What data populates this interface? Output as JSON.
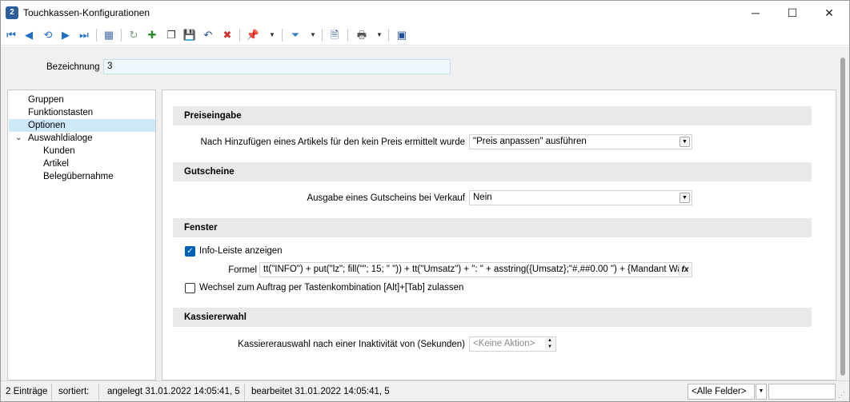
{
  "window": {
    "title": "Touchkassen-Konfigurationen",
    "app_icon_label": "2",
    "minimize_glyph": "─",
    "maximize_glyph": "☐",
    "close_glyph": "✕"
  },
  "toolbar": {
    "icons": [
      {
        "name": "first-record-icon",
        "glyph": "⏮",
        "color": "#1f6fc5"
      },
      {
        "name": "previous-record-icon",
        "glyph": "◀",
        "color": "#1f6fc5"
      },
      {
        "name": "refresh-record-icon",
        "glyph": "⟲",
        "color": "#1f6fc5"
      },
      {
        "name": "next-record-icon",
        "glyph": "▶",
        "color": "#1f6fc5"
      },
      {
        "name": "last-record-icon",
        "glyph": "⏭",
        "color": "#1f6fc5"
      },
      {
        "name": "table-view-icon",
        "glyph": "▦",
        "color": "#4a6fa5"
      },
      {
        "name": "reload-icon",
        "glyph": "↻",
        "color": "#7a9a7a"
      },
      {
        "name": "new-record-icon",
        "glyph": "✚",
        "color": "#2e8b2e"
      },
      {
        "name": "copy-record-icon",
        "glyph": "❐",
        "color": "#333333"
      },
      {
        "name": "save-icon",
        "glyph": "💾",
        "color": "#1f4f9c"
      },
      {
        "name": "undo-icon",
        "glyph": "↶",
        "color": "#1f4f9c"
      },
      {
        "name": "delete-record-icon",
        "glyph": "✖",
        "color": "#d03030"
      },
      {
        "name": "pin-icon",
        "glyph": "📌",
        "color": "#1f4f9c"
      },
      {
        "name": "filter-icon",
        "glyph": "⏷",
        "color": "#2f80d0"
      },
      {
        "name": "document-search-icon",
        "glyph": "🗎",
        "color": "#1f4f9c"
      },
      {
        "name": "print-icon",
        "glyph": "🖶",
        "color": "#555555"
      },
      {
        "name": "export-icon",
        "glyph": "▣",
        "color": "#1f4f9c"
      }
    ],
    "dropdown_glyph": "▼"
  },
  "header": {
    "bezeichnung_label": "Bezeichnung",
    "bezeichnung_value": "3"
  },
  "tree": {
    "expand_glyph": "⌄",
    "items": [
      {
        "label": "Gruppen"
      },
      {
        "label": "Funktionstasten"
      },
      {
        "label": "Optionen"
      },
      {
        "label": "Auswahldialoge"
      },
      {
        "label": "Kunden"
      },
      {
        "label": "Artikel"
      },
      {
        "label": "Belegübernahme"
      }
    ]
  },
  "sections": {
    "preiseingabe": {
      "title": "Preiseingabe",
      "label": "Nach Hinzufügen eines Artikels für den kein Preis ermittelt wurde",
      "value": "\"Preis anpassen\" ausführen"
    },
    "gutscheine": {
      "title": "Gutscheine",
      "label": "Ausgabe eines Gutscheins bei Verkauf",
      "value": "Nein"
    },
    "fenster": {
      "title": "Fenster",
      "info_leiste_label": "Info-Leiste anzeigen",
      "info_leiste_checked": true,
      "formel_label": "Formel",
      "formel_value": "tt(\"INFO\") + put(\"lz\"; fill(\"\"; 15; \" \")) + tt(\"Umsatz\") + \": \" + asstring({Umsatz};\"#,##0.00 \") + {Mandant Wa",
      "fx_label": "fx",
      "wechsel_label": "Wechsel zum Auftrag per Tastenkombination [Alt]+[Tab] zulassen",
      "wechsel_checked": false
    },
    "kassiererwahl": {
      "title": "Kassiererwahl",
      "label": "Kassiererauswahl nach einer Inaktivität von (Sekunden)",
      "value": "<Keine Aktion>"
    }
  },
  "check_glyph": "✓",
  "select_arrow_glyph": "▼",
  "spin_up_glyph": "▲",
  "spin_down_glyph": "▼",
  "statusbar": {
    "count": "2 Einträge",
    "sorted": "sortiert:",
    "created": "angelegt 31.01.2022 14:05:41,  5",
    "edited": "bearbeitet 31.01.2022 14:05:41,  5",
    "filter_value": "<Alle Felder>",
    "filter_arrow": "▼",
    "search_value": "",
    "grip": "⋰"
  }
}
